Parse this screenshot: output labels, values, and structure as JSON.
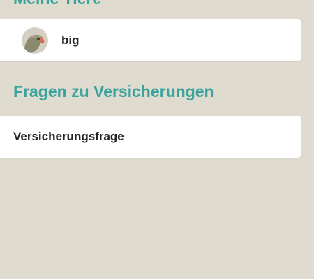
{
  "pets_section": {
    "title": "Meine Tiere",
    "pets": [
      {
        "name": "big",
        "avatar_icon": "parrot-icon"
      }
    ]
  },
  "questions_section": {
    "title": "Fragen zu Versicherungen",
    "items": [
      {
        "label": "Versicherungsfrage"
      }
    ]
  },
  "colors": {
    "background": "#dfdccf",
    "accent": "#3ba39d",
    "card": "#ffffff",
    "text": "#222222"
  }
}
